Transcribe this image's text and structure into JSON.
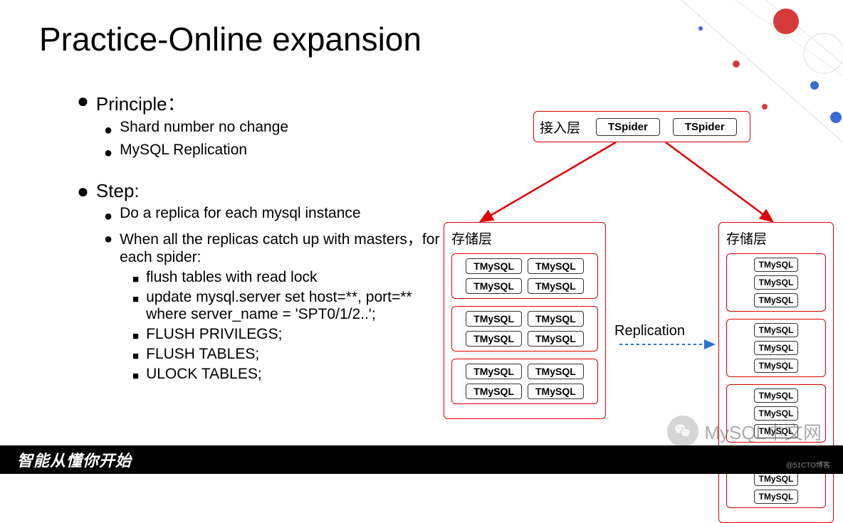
{
  "title": "Practice-Online expansion",
  "sections": {
    "principle": {
      "heading": "Principle：",
      "items": [
        "Shard number no change",
        "MySQL Replication"
      ]
    },
    "step": {
      "heading": "Step:",
      "items": [
        "Do a replica for each mysql instance",
        "When all the replicas catch up with masters，for each spider:"
      ],
      "sub_items": [
        "flush tables with read lock",
        "update mysql.server set host=**, port=** where server_name = 'SPT0/1/2..';",
        "FLUSH PRIVILEGS;",
        "FLUSH TABLES;",
        "ULOCK TABLES;"
      ]
    }
  },
  "diagram": {
    "access_layer_label": "接入层",
    "tspider_label": "TSpider",
    "storage_layer_label": "存储层",
    "tmysql_label": "TMySQL",
    "replication_label": "Replication",
    "left_groups": [
      4,
      4,
      4
    ],
    "right_groups": [
      3,
      3,
      3,
      3
    ]
  },
  "footer": {
    "slogan": "智能从懂你开始",
    "watermark": "@51CTO博客",
    "brand": "MySQL中文网"
  }
}
